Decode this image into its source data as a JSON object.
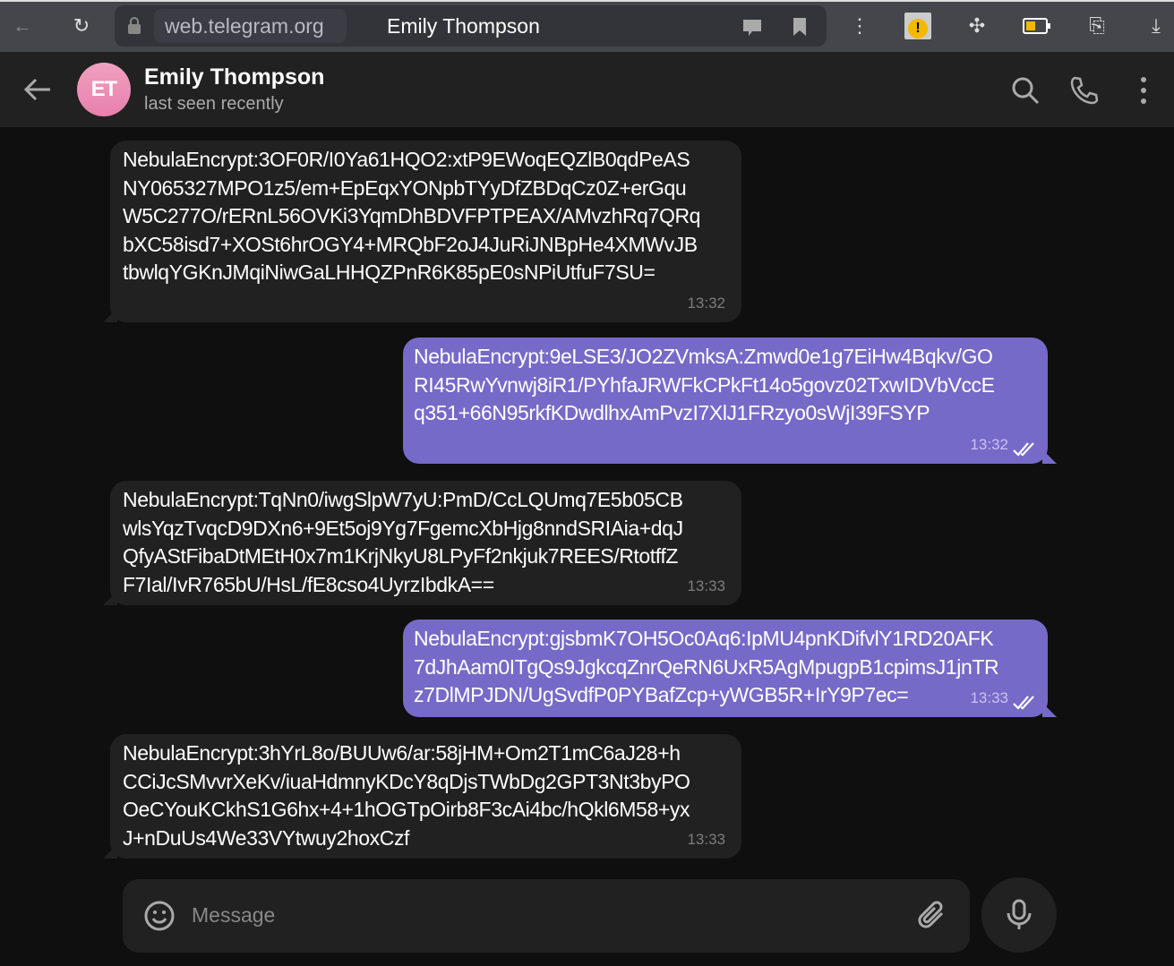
{
  "browser": {
    "url": "web.telegram.org",
    "tab_title": "Emily Thompson"
  },
  "chat_header": {
    "avatar_initials": "ET",
    "name": "Emily Thompson",
    "status": "last seen recently"
  },
  "messages": [
    {
      "direction": "incoming",
      "lines": [
        "NebulaEncrypt:3OF0R/I0Ya61HQO2:xtP9EWoqEQZlB0qdPeAS",
        "NY065327MPO1z5/em+EpEqxYONpbTYyDfZBDqCz0Z+erGqu",
        "W5C277O/rERnL56OVKi3YqmDhBDVFPTPEAX/AMvzhRq7QRq",
        "bXC58isd7+XOSt6hrOGY4+MRQbF2oJ4JuRiJNBpHe4XMWvJB",
        "tbwlqYGKnJMqiNiwGaLHHQZPnR6K85pE0sNPiUtfuF7SU="
      ],
      "time": "13:32"
    },
    {
      "direction": "outgoing",
      "lines": [
        "NebulaEncrypt:9eLSE3/JO2ZVmksA:Zmwd0e1g7EiHw4Bqkv/GO",
        "RI45RwYvnwj8iR1/PYhfaJRWFkCPkFt14o5govz02TxwIDVbVccE",
        "q351+66N95rkfKDwdlhxAmPvzI7XlJ1FRzyo0sWjI39FSYP"
      ],
      "time": "13:32",
      "read": true
    },
    {
      "direction": "incoming",
      "lines": [
        "NebulaEncrypt:TqNn0/iwgSlpW7yU:PmD/CcLQUmq7E5b05CB",
        "wlsYqzTvqcD9DXn6+9Et5oj9Yg7FgemcXbHjg8nndSRIAia+dqJ",
        "QfyAStFibaDtMEtH0x7m1KrjNkyU8LPyFf2nkjuk7REES/RtotffZ",
        "F7Ial/IvR765bU/HsL/fE8cso4UyrzIbdkA=="
      ],
      "time": "13:33"
    },
    {
      "direction": "outgoing",
      "lines": [
        "NebulaEncrypt:gjsbmK7OH5Oc0Aq6:IpMU4pnKDifvlY1RD20AFK",
        "7dJhAam0ITgQs9JgkcqZnrQeRN6UxR5AgMpugpB1cpimsJ1jnTR",
        "z7DlMPJDN/UgSvdfP0PYBafZcp+yWGB5R+IrY9P7ec="
      ],
      "time": "13:33",
      "read": true
    },
    {
      "direction": "incoming",
      "lines": [
        "NebulaEncrypt:3hYrL8o/BUUw6/ar:58jHM+Om2T1mC6aJ28+h",
        "CCiJcSMvvrXeKv/iuaHdmnyKDcY8qDjsTWbDg2GPT3Nt3byPO",
        "OeCYouKCkhS1G6hx+4+1hOGTpOirb8F3cAi4bc/hQkl6M58+yx",
        "J+nDuUs4We33VYtwuy2hoxCzf"
      ],
      "time": "13:33"
    }
  ],
  "composer": {
    "placeholder": "Message"
  },
  "colors": {
    "outgoing_bubble": "#766ac8",
    "incoming_bubble": "#212121",
    "header": "#212121",
    "background": "#0f0f0f"
  }
}
